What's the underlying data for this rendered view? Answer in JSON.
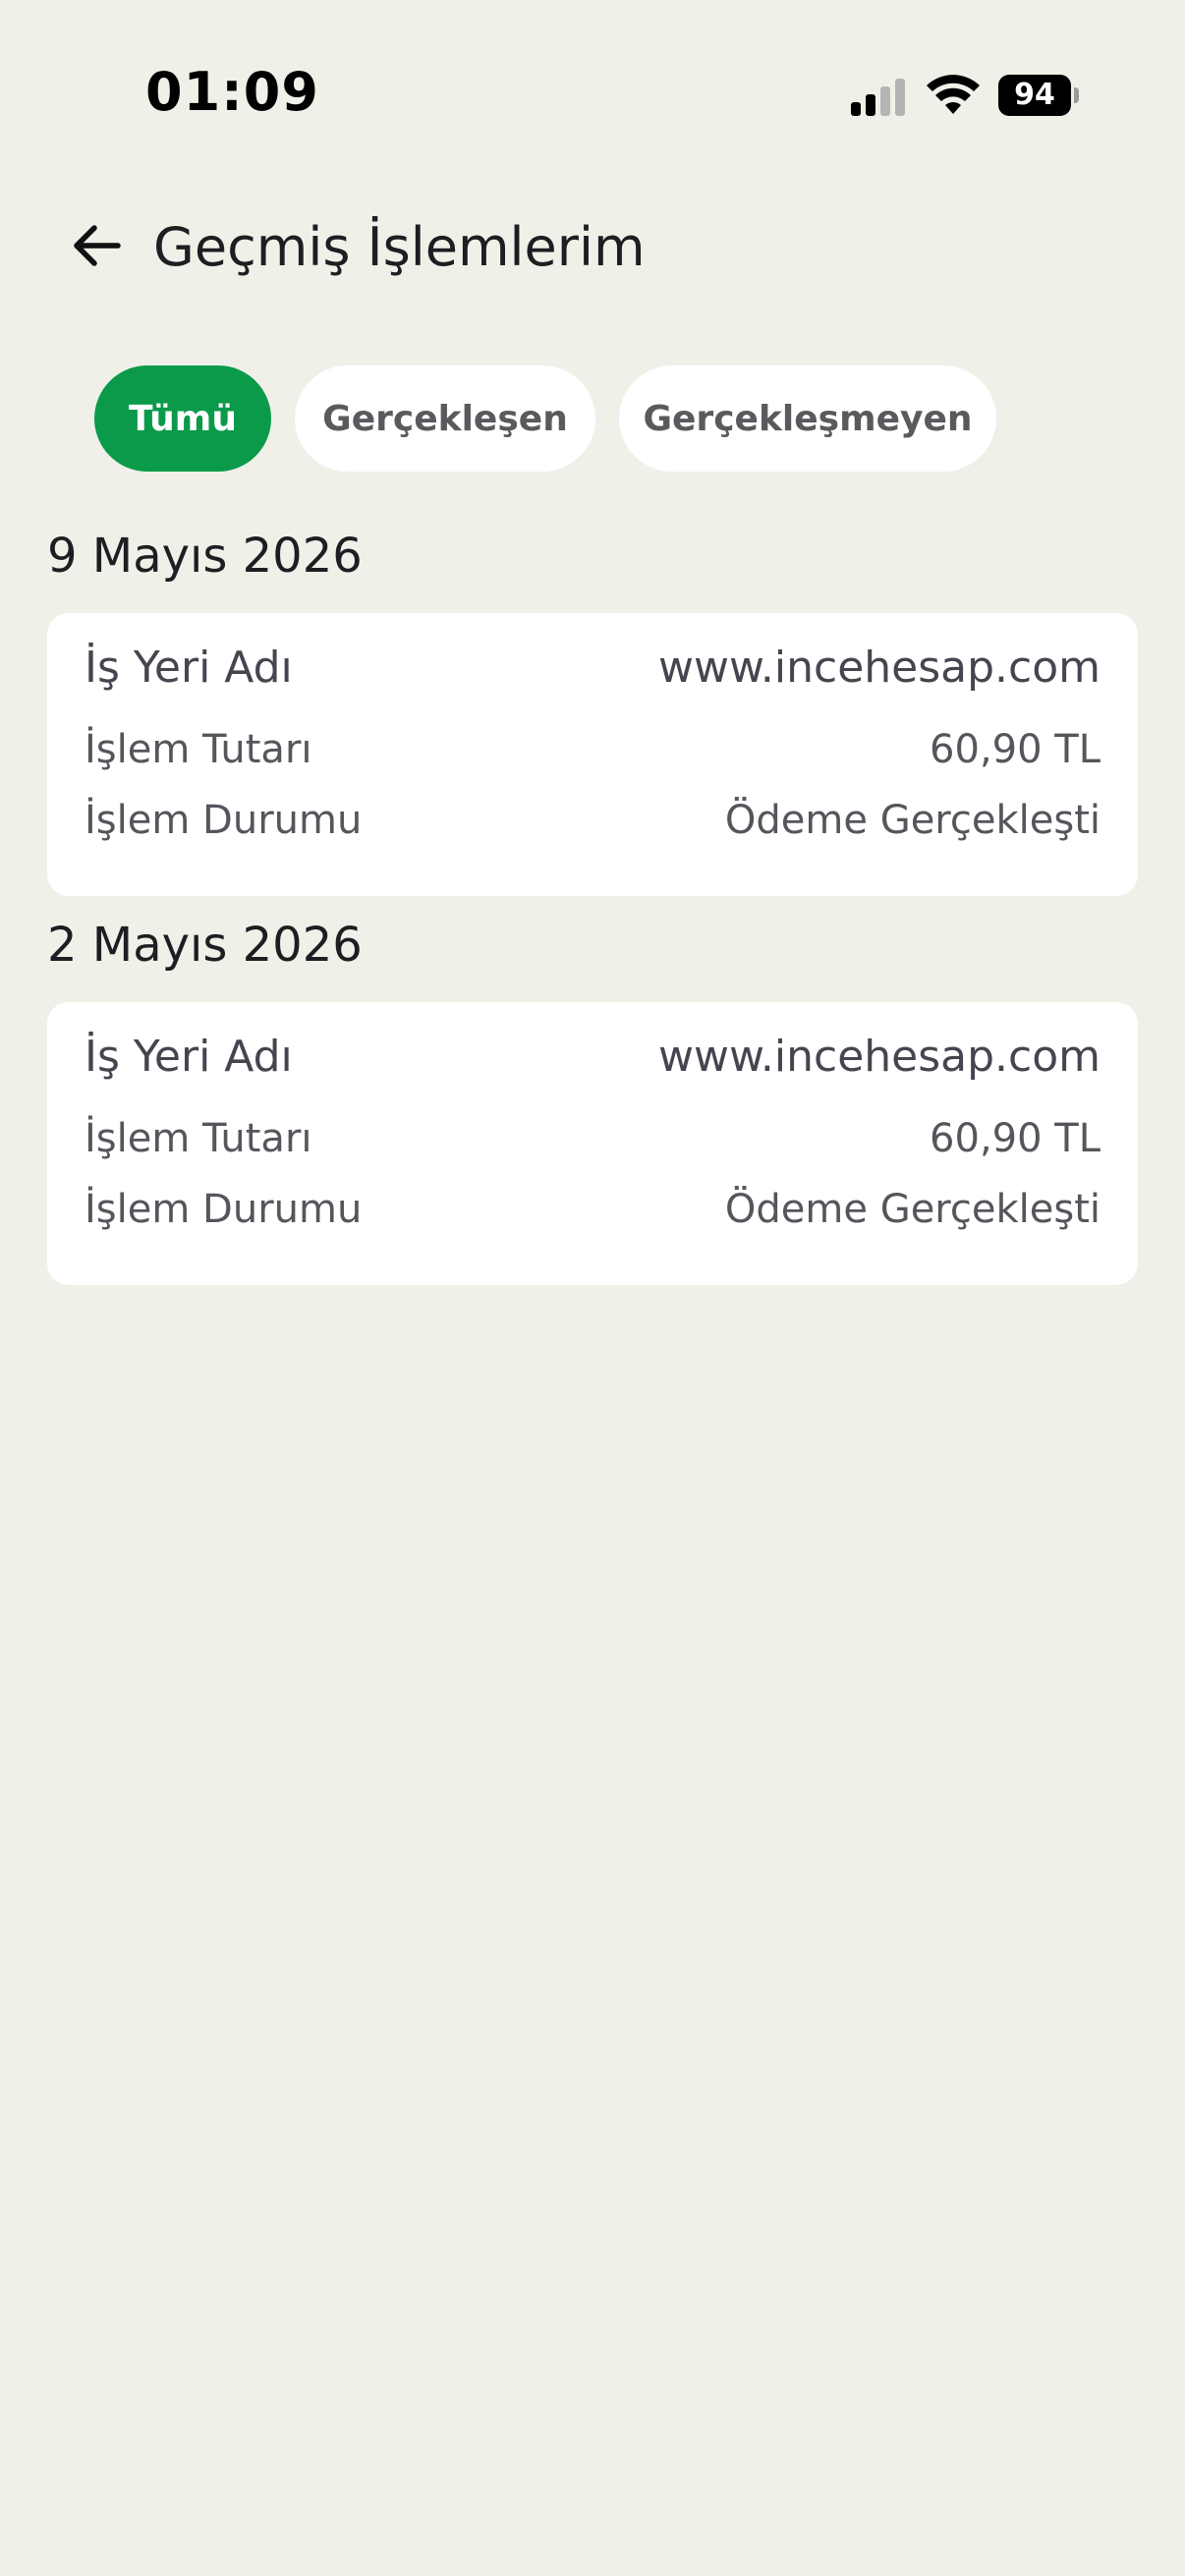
{
  "status_bar": {
    "time": "01:09",
    "battery": "94",
    "icons": [
      "signal-icon",
      "wifi-icon",
      "battery-icon"
    ]
  },
  "header": {
    "title": "Geçmiş İşlemlerim",
    "back_icon": "arrow-left-icon"
  },
  "filters": {
    "selected": "Tümü",
    "all": "Tümü",
    "completed": "Gerçekleşen",
    "failed": "Gerçekleşmeyen",
    "active_color": "#0a9a4a"
  },
  "sections": [
    {
      "date": "9 Mayıs 2026",
      "transaction": {
        "merchant_label": "İş Yeri Adı",
        "merchant_value": "www.incehesap.com",
        "amount_label": "İşlem Tutarı",
        "amount_value": "60,90 TL",
        "status_label": "İşlem Durumu",
        "status_value": "Ödeme Gerçekleşti"
      }
    },
    {
      "date": "2 Mayıs 2026",
      "transaction": {
        "merchant_label": "İş Yeri Adı",
        "merchant_value": "www.incehesap.com",
        "amount_label": "İşlem Tutarı",
        "amount_value": "60,90 TL",
        "status_label": "İşlem Durumu",
        "status_value": "Ödeme Gerçekleşti"
      }
    }
  ]
}
